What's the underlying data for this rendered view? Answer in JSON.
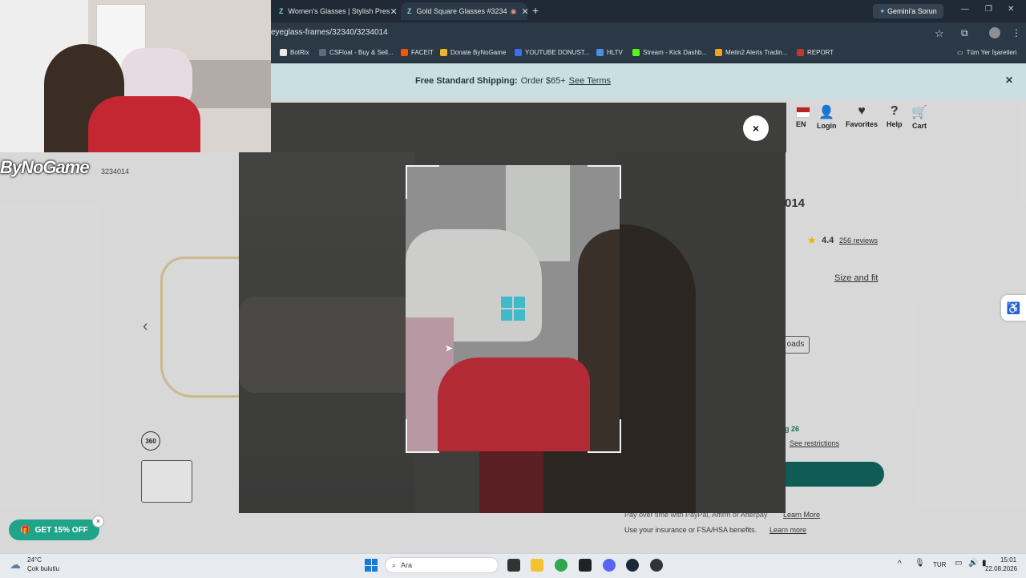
{
  "browser": {
    "tabs": [
      {
        "label": "Women's Glasses | Stylish Pres",
        "favicon": "Z"
      },
      {
        "label": "Gold Square Glasses #3234",
        "favicon": "Z"
      }
    ],
    "new_tab": "+",
    "gemini_label": "Gemini'a Sorun",
    "url": "eyeglass-frames/32340/3234014",
    "bookmarks": [
      {
        "label": "BotRix",
        "color": "#e8e8e8"
      },
      {
        "label": "CSFloat - Buy & Sell...",
        "color": "#5b6b7c"
      },
      {
        "label": "FACEIT",
        "color": "#ff5500"
      },
      {
        "label": "Donate ByNoGame",
        "color": "#f0b429"
      },
      {
        "label": "YOUTUBE DONUST...",
        "color": "#3f6df2"
      },
      {
        "label": "HLTV",
        "color": "#4a90e2"
      },
      {
        "label": "Stream - Kick Dashb...",
        "color": "#53fc18"
      },
      {
        "label": "Metin2 Alerts Tradin...",
        "color": "#f7a21b"
      },
      {
        "label": "REPORT",
        "color": "#c0392b"
      }
    ],
    "all_bookmarks": "Tüm Yer İşaretleri"
  },
  "page": {
    "shipping": {
      "bold": "Free Standard Shipping:",
      "text": "Order $65+",
      "link": "See Terms"
    },
    "nav": {
      "lang": "EN",
      "login": "Login",
      "favorites": "Favorites",
      "help": "Help",
      "cart": "Cart"
    },
    "sku_tail": "3234014",
    "title_tail": "014",
    "rating": "4.4",
    "reviews": "256 reviews",
    "size_fit": "Size and fit",
    "uploads_tail": "oads",
    "aug_tail": "g 26",
    "see_restrictions": "See restrictions",
    "pay_over_time": "Pay over time with PayPal, Affirm or Afterpay",
    "learn_more_1": "Learn More",
    "insurance": "Use your insurance or FSA/HSA benefits.",
    "learn_more_2": "Learn more",
    "view360": "360",
    "promo": "GET 15% OFF",
    "promo_close": "×",
    "prev_arrow": "‹"
  },
  "overlay": {
    "streamer_logo": "ByNoGame",
    "close": "×"
  },
  "taskbar": {
    "weather_temp": "24°C",
    "weather_desc": "Çok bulutlu",
    "search_placeholder": "Ara",
    "lang": "TUR",
    "time": "15:01",
    "date": "22.08.2026"
  }
}
